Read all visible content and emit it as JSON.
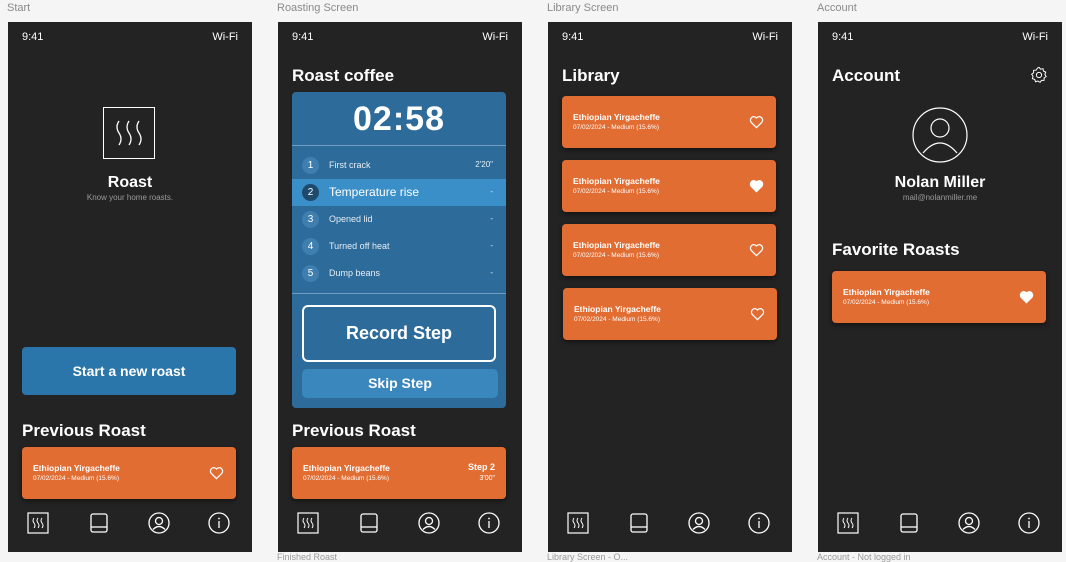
{
  "frames": [
    {
      "label": "Start"
    },
    {
      "label": "Roasting Screen"
    },
    {
      "label": "Library Screen"
    },
    {
      "label": "Account"
    }
  ],
  "sub_labels": [
    "Finished Roast",
    "Library Screen - O...",
    "Account - Not logged in"
  ],
  "status": {
    "time": "9:41",
    "wifi": "Wi-Fi"
  },
  "start": {
    "app_title": "Roast",
    "tagline": "Know your home roasts.",
    "start_button": "Start a new roast",
    "previous_heading": "Previous Roast",
    "previous_card": {
      "title": "Ethiopian Yirgacheffe",
      "subtitle": "07/02/2024 - Medium (15.6%)"
    }
  },
  "roasting": {
    "heading": "Roast coffee",
    "timer": "02:58",
    "steps": [
      {
        "num": "1",
        "label": "First crack",
        "value": "2'20\""
      },
      {
        "num": "2",
        "label": "Temperature rise",
        "value": "-"
      },
      {
        "num": "3",
        "label": "Opened lid",
        "value": "-"
      },
      {
        "num": "4",
        "label": "Turned off heat",
        "value": "-"
      },
      {
        "num": "5",
        "label": "Dump beans",
        "value": "-"
      }
    ],
    "active_step": 2,
    "record_button": "Record Step",
    "skip_button": "Skip Step",
    "previous_heading": "Previous Roast",
    "previous_card": {
      "title": "Ethiopian Yirgacheffe",
      "subtitle": "07/02/2024 - Medium (15.6%)",
      "step": "Step 2",
      "step_time": "3'00\""
    }
  },
  "library": {
    "heading": "Library",
    "items": [
      {
        "title": "Ethiopian Yirgacheffe",
        "subtitle": "07/02/2024 - Medium (15.6%)",
        "favorite": false
      },
      {
        "title": "Ethiopian Yirgacheffe",
        "subtitle": "07/02/2024 - Medium (15.6%)",
        "favorite": true
      },
      {
        "title": "Ethiopian Yirgacheffe",
        "subtitle": "07/02/2024 - Medium (15.6%)",
        "favorite": false
      },
      {
        "title": "Ethiopian Yirgacheffe",
        "subtitle": "07/02/2024 - Medium (15.6%)",
        "favorite": false
      }
    ]
  },
  "account": {
    "heading": "Account",
    "name": "Nolan Miller",
    "email": "mail@nolanmiller.me",
    "favorites_heading": "Favorite Roasts",
    "favorite_card": {
      "title": "Ethiopian Yirgacheffe",
      "subtitle": "07/02/2024 - Medium (15.6%)",
      "favorite": true
    }
  },
  "tabs": [
    {
      "icon": "roast-icon"
    },
    {
      "icon": "library-icon"
    },
    {
      "icon": "account-icon"
    },
    {
      "icon": "info-icon"
    }
  ],
  "colors": {
    "background": "#232323",
    "accent_orange": "#e16d33",
    "accent_blue": "#2d6b9a",
    "button_blue": "#2a76aa"
  }
}
